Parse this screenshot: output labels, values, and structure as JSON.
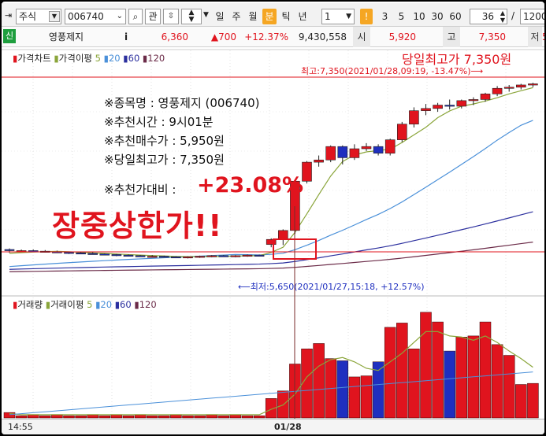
{
  "toolbar": {
    "market": "주식",
    "code": "006740",
    "icon_search": "search-icon",
    "kwan": "관",
    "period_tabs": [
      "일",
      "주",
      "월",
      "분",
      "틱",
      "년"
    ],
    "active_period": "분",
    "interval_value": "1",
    "alert": "!",
    "minute_buttons": [
      "3",
      "5",
      "10",
      "30",
      "60"
    ],
    "count_value": "36",
    "slash": "/",
    "total_value": "1200"
  },
  "quote": {
    "badge": "신",
    "name": "영풍제지",
    "info": "i",
    "price": "6,360",
    "change": "▲700",
    "change_pct": "+12.37%",
    "volume": "9,430,558",
    "open_label": "시",
    "open": "5,920",
    "high_label": "고",
    "high": "7,350",
    "low_label": "저",
    "low_tail": "5"
  },
  "price_legend": {
    "chart_label": "가격차트",
    "ma_label": "가격이평",
    "ma": [
      "5",
      "20",
      "60",
      "120"
    ]
  },
  "volume_legend": {
    "chart_label": "거래량",
    "ma_label": "거래이평",
    "ma": [
      "5",
      "20",
      "60",
      "120"
    ]
  },
  "annotations": {
    "high_line": "최고:7,350(2021/01/28,09:19, -13.47%)⟶",
    "low_line": "⟵최저:5,650(2021/01/27,15:18, +12.57%)",
    "day_high_label": "당일최고가 7,350원",
    "stock_name": "※종목명 : 영풍제지 (006740)",
    "rec_time": "※추천시간 : 9시01분",
    "rec_price": "※추천매수가 : 5,950원",
    "day_high": "※당일최고가 : 7,350원",
    "vs_label": "※추천가대비 :",
    "vs_value": "+23.08%",
    "limit_up": "장중상한가!!"
  },
  "xaxis": {
    "left_time": "14:55",
    "date": "01/28"
  },
  "colors": {
    "up": "#e0141e",
    "down": "#1f2fbf",
    "ma5": "#8aa53a",
    "ma20": "#4a90d9",
    "ma60": "#2b2f9e",
    "ma120": "#6b2b48"
  },
  "chart_data": [
    {
      "type": "candlestick",
      "title": "가격차트",
      "series": [
        {
          "name": "가격차트",
          "ohlc": [
            [
              5860,
              5870,
              5830,
              5850
            ],
            [
              5850,
              5860,
              5840,
              5850
            ],
            [
              5850,
              5860,
              5840,
              5845
            ],
            [
              5845,
              5855,
              5835,
              5840
            ],
            [
              5840,
              5850,
              5830,
              5835
            ],
            [
              5835,
              5840,
              5820,
              5830
            ],
            [
              5830,
              5840,
              5820,
              5825
            ],
            [
              5825,
              5835,
              5815,
              5820
            ],
            [
              5820,
              5825,
              5810,
              5815
            ],
            [
              5815,
              5820,
              5800,
              5810
            ],
            [
              5810,
              5815,
              5800,
              5805
            ],
            [
              5805,
              5810,
              5795,
              5800
            ],
            [
              5800,
              5810,
              5790,
              5800
            ],
            [
              5800,
              5805,
              5790,
              5795
            ],
            [
              5795,
              5800,
              5785,
              5790
            ],
            [
              5790,
              5800,
              5780,
              5795
            ],
            [
              5795,
              5805,
              5785,
              5800
            ],
            [
              5800,
              5810,
              5790,
              5805
            ],
            [
              5805,
              5810,
              5795,
              5800
            ],
            [
              5800,
              5810,
              5790,
              5805
            ],
            [
              5805,
              5815,
              5795,
              5810
            ],
            [
              5810,
              5815,
              5800,
              5805
            ],
            [
              5905,
              5960,
              5880,
              5950
            ],
            [
              5950,
              6040,
              5900,
              6030
            ],
            [
              6030,
              6480,
              6000,
              6470
            ],
            [
              6470,
              6650,
              6450,
              6640
            ],
            [
              6640,
              6700,
              6600,
              6660
            ],
            [
              6660,
              6790,
              6640,
              6780
            ],
            [
              6780,
              6790,
              6620,
              6680
            ],
            [
              6680,
              6800,
              6660,
              6760
            ],
            [
              6760,
              6810,
              6740,
              6780
            ],
            [
              6780,
              6800,
              6700,
              6720
            ],
            [
              6720,
              6850,
              6700,
              6840
            ],
            [
              6840,
              7000,
              6820,
              6980
            ],
            [
              6980,
              7130,
              6950,
              7100
            ],
            [
              7100,
              7160,
              7060,
              7120
            ],
            [
              7120,
              7170,
              7090,
              7150
            ],
            [
              7150,
              7200,
              7110,
              7140
            ],
            [
              7140,
              7200,
              7120,
              7190
            ],
            [
              7190,
              7220,
              7150,
              7200
            ],
            [
              7200,
              7260,
              7180,
              7250
            ],
            [
              7250,
              7320,
              7230,
              7300
            ],
            [
              7300,
              7330,
              7270,
              7310
            ],
            [
              7310,
              7340,
              7290,
              7330
            ],
            [
              7330,
              7350,
              7310,
              7340
            ]
          ]
        }
      ],
      "annotations": [
        "최고:7,350(2021/01/28,09:19, -13.47%)",
        "최저:5,650(2021/01/27,15:18, +12.57%)"
      ]
    },
    {
      "type": "bar",
      "title": "거래량",
      "series": [
        {
          "name": "거래량",
          "values": [
            5,
            2,
            3,
            2,
            3,
            2,
            2,
            3,
            2,
            3,
            2,
            3,
            2,
            2,
            3,
            2,
            2,
            3,
            2,
            3,
            2,
            2,
            18,
            25,
            50,
            64,
            69,
            55,
            53,
            38,
            39,
            52,
            84,
            88,
            64,
            98,
            89,
            62,
            75,
            76,
            89,
            68,
            58,
            31,
            32
          ]
        },
        {
          "name": "5",
          "values": [
            4,
            3,
            3,
            3,
            3,
            3,
            3,
            3,
            3,
            3,
            3,
            3,
            3,
            3,
            3,
            3,
            3,
            3,
            3,
            3,
            3,
            3,
            8,
            12,
            22,
            38,
            48,
            54,
            56,
            52,
            46,
            44,
            52,
            60,
            70,
            80,
            80,
            76,
            75,
            72,
            76,
            70,
            62,
            55,
            47
          ]
        }
      ]
    }
  ]
}
